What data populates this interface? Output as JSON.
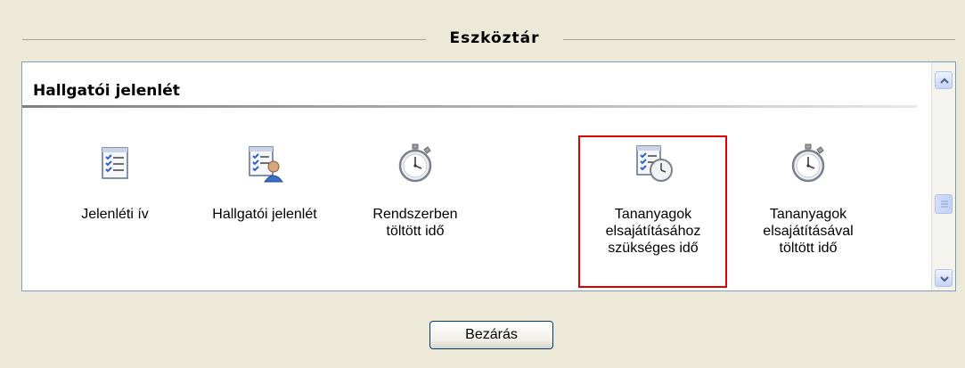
{
  "toolbar": {
    "title": "Eszköztár"
  },
  "section": {
    "title": "Hallgatói jelenlét"
  },
  "tools": [
    {
      "lines": [
        "Jelenléti ív"
      ],
      "icon": "checklist-icon"
    },
    {
      "lines": [
        "Hallgatói jelenlét"
      ],
      "icon": "checklist-person-icon"
    },
    {
      "lines": [
        "Rendszerben",
        "töltött idő"
      ],
      "icon": "stopwatch-icon"
    },
    {
      "lines": [
        "Tananyagok",
        "elsajátításához",
        "szükséges idő"
      ],
      "icon": "checklist-clock-icon"
    },
    {
      "lines": [
        "Tananyagok",
        "elsajátításával",
        "töltött idő"
      ],
      "icon": "stopwatch-icon"
    }
  ],
  "buttons": {
    "close_label": "Bezárás"
  },
  "colors": {
    "highlight": "#e00000",
    "background": "#ece9d8",
    "panel": "#ffffff"
  }
}
